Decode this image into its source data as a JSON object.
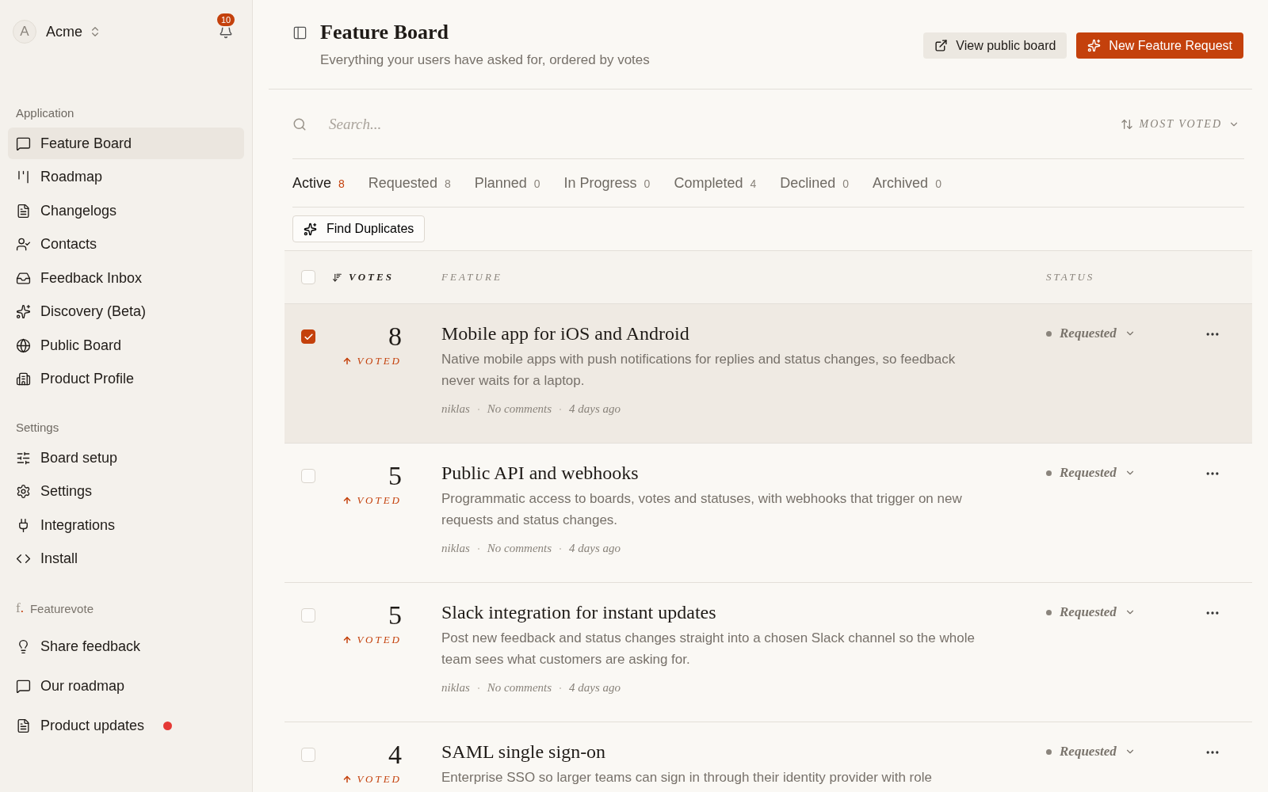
{
  "workspace": {
    "avatar": "A",
    "name": "Acme",
    "notifications": "10"
  },
  "sidebar": {
    "sections": [
      {
        "title": "Application",
        "items": [
          {
            "label": "Feature Board",
            "selected": true
          },
          {
            "label": "Roadmap",
            "selected": false
          },
          {
            "label": "Changelogs",
            "selected": false
          },
          {
            "label": "Contacts",
            "selected": false
          },
          {
            "label": "Feedback Inbox",
            "selected": false
          },
          {
            "label": "Discovery (Beta)",
            "selected": false
          },
          {
            "label": "Public Board",
            "selected": false
          },
          {
            "label": "Product Profile",
            "selected": false
          }
        ]
      },
      {
        "title": "Settings",
        "items": [
          {
            "label": "Board setup",
            "selected": false
          },
          {
            "label": "Settings",
            "selected": false
          },
          {
            "label": "Integrations",
            "selected": false
          },
          {
            "label": "Install",
            "selected": false
          }
        ]
      }
    ],
    "featurevote": {
      "logo": "f.",
      "title": "Featurevote",
      "items": [
        {
          "label": "Share feedback",
          "unread": false
        },
        {
          "label": "Our roadmap",
          "unread": false
        },
        {
          "label": "Product updates",
          "unread": true
        }
      ]
    }
  },
  "header": {
    "title": "Feature Board",
    "subtitle": "Everything your users have asked for, ordered by votes",
    "buttons": [
      {
        "label": "View public board",
        "kind": "secondary"
      },
      {
        "label": "New Feature Request",
        "kind": "primary"
      }
    ]
  },
  "search": {
    "placeholder": "Search...",
    "sort": "MOST VOTED"
  },
  "tabs": [
    {
      "label": "Active",
      "count": "8",
      "selected": true
    },
    {
      "label": "Requested",
      "count": "8",
      "selected": false
    },
    {
      "label": "Planned",
      "count": "0",
      "selected": false
    },
    {
      "label": "In Progress",
      "count": "0",
      "selected": false
    },
    {
      "label": "Completed",
      "count": "4",
      "selected": false
    },
    {
      "label": "Declined",
      "count": "0",
      "selected": false
    },
    {
      "label": "Archived",
      "count": "0",
      "selected": false
    }
  ],
  "find_duplicates": "Find Duplicates",
  "table": {
    "columns": [
      "VOTES",
      "FEATURE",
      "STATUS"
    ],
    "select_all": false,
    "rows": [
      {
        "votes": "8",
        "voted": true,
        "voted_label": "VOTED",
        "title": "Mobile app for iOS and Android",
        "description": "Native mobile apps with push notifications for replies and status changes, so feedback never waits for a laptop.",
        "author": "niklas",
        "comments": "No comments",
        "time": "4 days ago",
        "status": "Requested",
        "selected": true
      },
      {
        "votes": "5",
        "voted": true,
        "voted_label": "VOTED",
        "title": "Public API and webhooks",
        "description": "Programmatic access to boards, votes and statuses, with webhooks that trigger on new requests and status changes.",
        "author": "niklas",
        "comments": "No comments",
        "time": "4 days ago",
        "status": "Requested",
        "selected": false
      },
      {
        "votes": "5",
        "voted": true,
        "voted_label": "VOTED",
        "title": "Slack integration for instant updates",
        "description": "Post new feedback and status changes straight into a chosen Slack channel so the whole team sees what customers are asking for.",
        "author": "niklas",
        "comments": "No comments",
        "time": "4 days ago",
        "status": "Requested",
        "selected": false
      },
      {
        "votes": "4",
        "voted": true,
        "voted_label": "VOTED",
        "title": "SAML single sign-on",
        "description": "Enterprise SSO so larger teams can sign in through their identity provider with role",
        "status": "Requested",
        "selected": false
      }
    ]
  }
}
